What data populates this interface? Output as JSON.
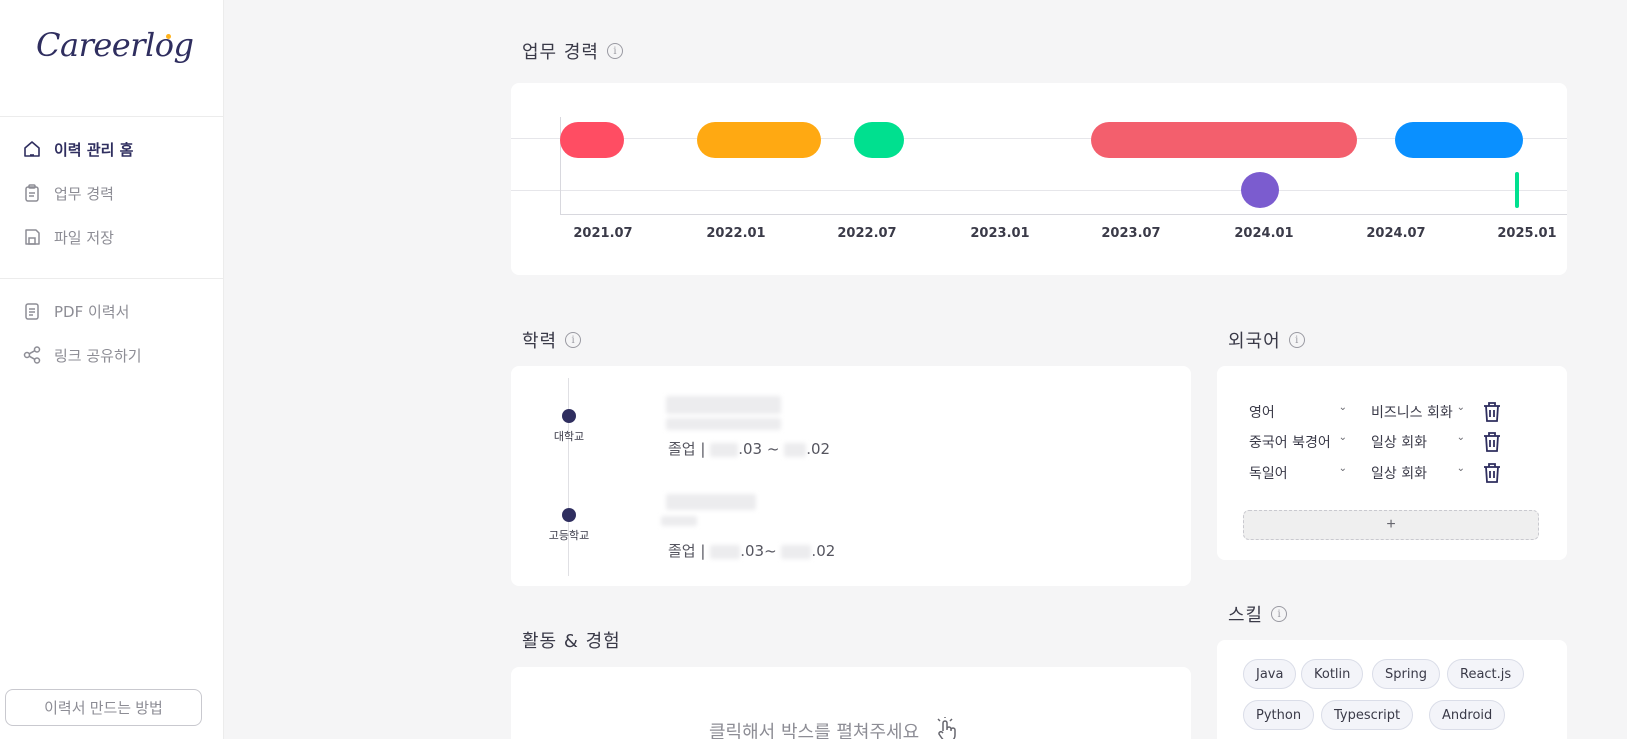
{
  "app": {
    "logo_text": "Careerlog"
  },
  "sidebar": {
    "items": [
      {
        "label": "이력 관리 홈",
        "icon": "home-icon",
        "active": true
      },
      {
        "label": "업무 경력",
        "icon": "clipboard-icon",
        "active": false
      },
      {
        "label": "파일 저장",
        "icon": "save-icon",
        "active": false
      },
      {
        "label": "PDF 이력서",
        "icon": "document-icon",
        "active": false
      },
      {
        "label": "링크 공유하기",
        "icon": "share-icon",
        "active": false
      }
    ],
    "help_button": "이력서 만드는 방법"
  },
  "career": {
    "title": "업무 경력",
    "ticks": [
      "2021.07",
      "2022.01",
      "2022.07",
      "2023.01",
      "2023.07",
      "2024.01",
      "2024.07",
      "2025.01"
    ],
    "colors": {
      "red": "#ff4d63",
      "orange": "#ffa912",
      "green": "#00e08f",
      "salmon": "#f35f6d",
      "purple": "#7b5ccf",
      "blue": "#0a90ff"
    }
  },
  "education": {
    "title": "학력",
    "items": [
      {
        "level": "대학교",
        "status": "졸업 |",
        "period_visible": ".03 ~ ",
        "period_end": ".02"
      },
      {
        "level": "고등학교",
        "status": "졸업 |",
        "period_visible": ".03~ ",
        "period_end": ".02"
      }
    ]
  },
  "languages": {
    "title": "외국어",
    "items": [
      {
        "language": "영어",
        "level": "비즈니스 회화"
      },
      {
        "language": "중국어 북경어",
        "level": "일상 회화"
      },
      {
        "language": "독일어",
        "level": "일상 회화"
      }
    ],
    "add_label": "+"
  },
  "activities": {
    "title": "활동 & 경험",
    "hint": "클릭해서 박스를 펼쳐주세요"
  },
  "skills": {
    "title": "스킬",
    "items": [
      "Java",
      "Kotlin",
      "Spring",
      "React.js",
      "Python",
      "Typescript",
      "Android"
    ]
  }
}
